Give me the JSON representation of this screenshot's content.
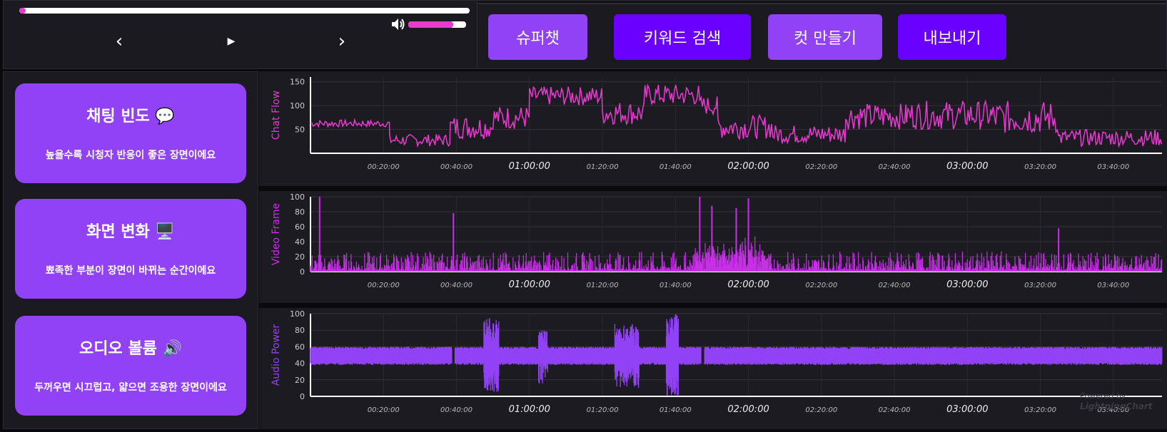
{
  "player": {
    "progress": 0.015,
    "volume": 0.78,
    "prev_icon": "‹",
    "play_icon": "▶",
    "next_icon": "›"
  },
  "toolbar": {
    "buttons": [
      {
        "label": "슈퍼챗",
        "color": "#9242f5"
      },
      {
        "label": "키워드 검색",
        "color": "#6a00ff"
      },
      {
        "label": "컷 만들기",
        "color": "#9242f5"
      },
      {
        "label": "내보내기",
        "color": "#6a00ff"
      }
    ]
  },
  "sidebar": {
    "cards": [
      {
        "title": "채팅 빈도 💬",
        "desc": "높을수록 시청자 반응이 좋은 장면이에요"
      },
      {
        "title": "화면 변화 🖥️",
        "desc": "뾰족한 부분이 장면이 바뀌는 순간이에요"
      },
      {
        "title": "오디오 볼륨 🔊",
        "desc": "두꺼우면 시끄럽고, 얇으면 조용한 장면이에요"
      }
    ]
  },
  "watermark": {
    "line1": "Powered by",
    "line2": "LightningChart"
  },
  "colors": {
    "chat": "#e83ad0",
    "video": "#c830e8",
    "audio": "#9242f5",
    "accent": "#9242f5"
  },
  "chart_data": [
    {
      "type": "line",
      "ylabel": "Chat Flow",
      "ylim": [
        0,
        160
      ],
      "yticks": [
        50,
        100,
        150
      ],
      "x_ticks": [
        "00:20:00",
        "00:40:00",
        "01:00:00",
        "01:20:00",
        "01:40:00",
        "02:00:00",
        "02:20:00",
        "02:40:00",
        "03:00:00",
        "03:20:00",
        "03:40:00"
      ],
      "x_range_seconds": [
        0,
        14000
      ],
      "segments": [
        {
          "x": [
            0,
            1300
          ],
          "y": [
            55,
            70
          ]
        },
        {
          "x": [
            1300,
            2300
          ],
          "y": [
            15,
            40
          ]
        },
        {
          "x": [
            2300,
            3000
          ],
          "y": [
            30,
            80
          ]
        },
        {
          "x": [
            3000,
            3600
          ],
          "y": [
            50,
            100
          ]
        },
        {
          "x": [
            3600,
            4800
          ],
          "y": [
            100,
            140
          ]
        },
        {
          "x": [
            4800,
            5500
          ],
          "y": [
            60,
            110
          ]
        },
        {
          "x": [
            5500,
            6400
          ],
          "y": [
            100,
            145
          ]
        },
        {
          "x": [
            6400,
            6700
          ],
          "y": [
            80,
            120
          ]
        },
        {
          "x": [
            6700,
            7600
          ],
          "y": [
            30,
            80
          ]
        },
        {
          "x": [
            7600,
            8800
          ],
          "y": [
            20,
            60
          ]
        },
        {
          "x": [
            8800,
            9800
          ],
          "y": [
            50,
            105
          ]
        },
        {
          "x": [
            9800,
            11200
          ],
          "y": [
            50,
            110
          ]
        },
        {
          "x": [
            11200,
            12300
          ],
          "y": [
            40,
            110
          ]
        },
        {
          "x": [
            12300,
            14000
          ],
          "y": [
            15,
            50
          ]
        }
      ]
    },
    {
      "type": "line",
      "ylabel": "Video Frame",
      "ylim": [
        0,
        100
      ],
      "yticks": [
        0,
        20,
        40,
        60,
        80,
        100
      ],
      "x_ticks": [
        "00:20:00",
        "00:40:00",
        "01:00:00",
        "01:20:00",
        "01:40:00",
        "02:00:00",
        "02:20:00",
        "02:40:00",
        "03:00:00",
        "03:20:00",
        "03:40:00"
      ],
      "x_range_seconds": [
        0,
        14000
      ],
      "peaks": [
        {
          "x": 150,
          "y": 100
        },
        {
          "x": 2350,
          "y": 78
        },
        {
          "x": 6400,
          "y": 100
        },
        {
          "x": 6600,
          "y": 88
        },
        {
          "x": 7000,
          "y": 85
        },
        {
          "x": 7200,
          "y": 98
        },
        {
          "x": 12300,
          "y": 58
        }
      ],
      "baseline": [
        2,
        25
      ]
    },
    {
      "type": "area",
      "ylabel": "Audio Power",
      "ylim": [
        0,
        100
      ],
      "yticks": [
        0,
        20,
        40,
        60,
        80,
        100
      ],
      "x_ticks": [
        "00:20:00",
        "00:40:00",
        "01:00:00",
        "01:20:00",
        "01:40:00",
        "02:00:00",
        "02:20:00",
        "02:40:00",
        "03:00:00",
        "03:20:00",
        "03:40:00"
      ],
      "x_range_seconds": [
        0,
        14000
      ],
      "band": [
        38,
        60
      ],
      "bursts": [
        {
          "x": [
            2850,
            3100
          ],
          "low": 5,
          "high": 95
        },
        {
          "x": [
            3750,
            3900
          ],
          "low": 15,
          "high": 80
        },
        {
          "x": [
            5000,
            5400
          ],
          "low": 10,
          "high": 88
        },
        {
          "x": [
            5850,
            6050
          ],
          "low": 0,
          "high": 100
        }
      ],
      "gaps": [
        2350,
        6450
      ]
    }
  ]
}
